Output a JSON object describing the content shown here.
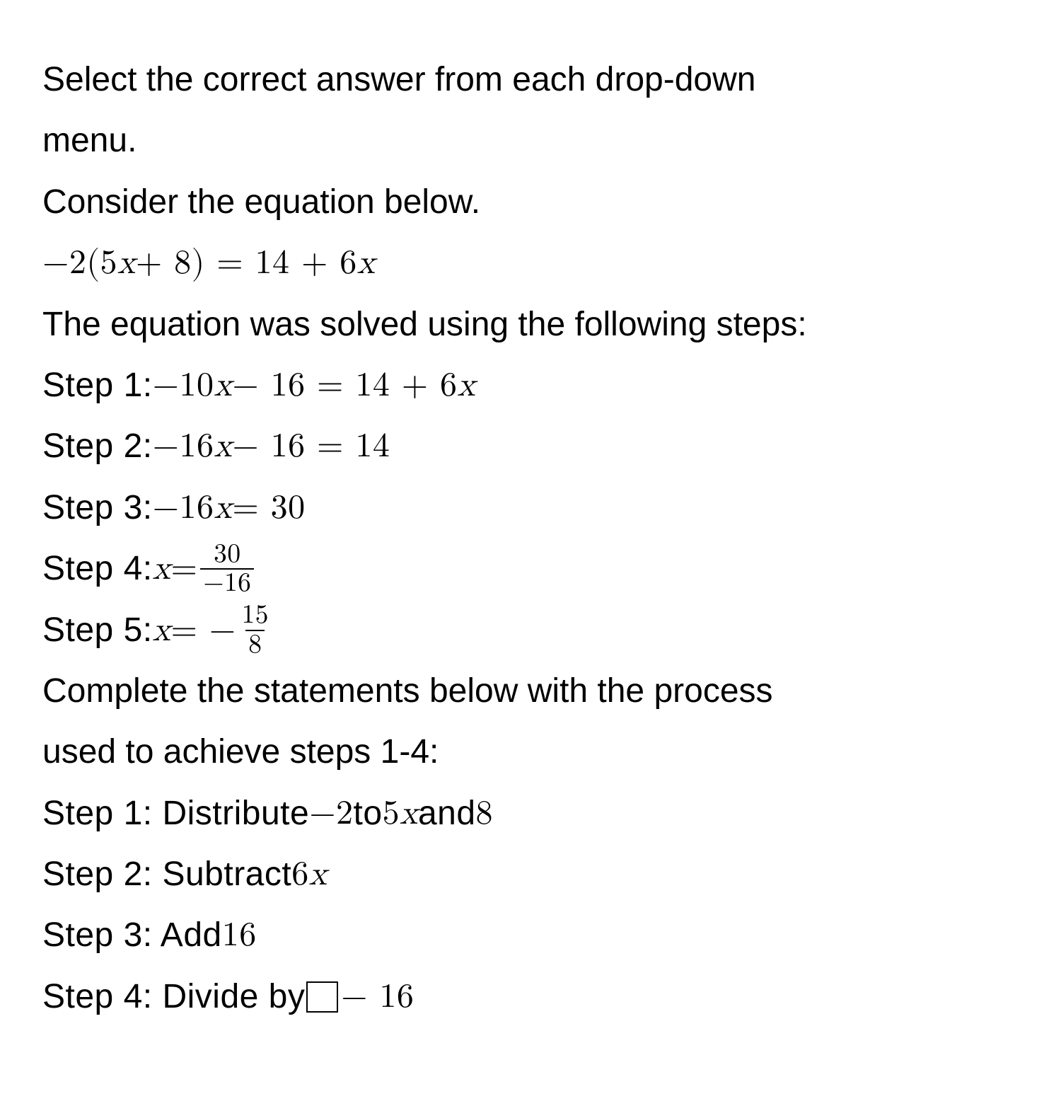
{
  "intro": {
    "line1": "Select the correct answer from each drop-down",
    "line2": "menu.",
    "consider": "Consider the equation below."
  },
  "equation": {
    "lhs_prefix": "−2(5",
    "lhs_var": "x",
    "lhs_mid": " + 8) = 14 + 6",
    "lhs_var2": "x"
  },
  "solved_intro": "The equation was solved using the following steps:",
  "steps_work": {
    "s1_label": "Step 1:  ",
    "s1_a": "−10",
    "s1_v1": "x",
    "s1_b": " − 16 = 14 + 6",
    "s1_v2": "x",
    "s2_label": "Step 2:  ",
    "s2_a": "−16",
    "s2_v1": "x",
    "s2_b": " − 16 = 14",
    "s3_label": "Step 3:  ",
    "s3_a": "−16",
    "s3_v1": "x",
    "s3_b": " = 30",
    "s4_label": "Step 4:  ",
    "s4_v": "x",
    "s4_eq": " = ",
    "s4_num": "30",
    "s4_den": "−16",
    "s5_label": "Step 5:  ",
    "s5_v": "x",
    "s5_eq": " = −",
    "s5_num": "15",
    "s5_den": "8"
  },
  "complete": {
    "line1": "Complete the statements below with the process",
    "line2": "used to achieve steps 1-4:"
  },
  "answers": {
    "s1_label": "Step 1: Distribute ",
    "s1_m1": " −2 ",
    "s1_to": " to ",
    "s1_m2": " 5",
    "s1_mv": "x",
    "s1_and": "  and ",
    "s1_m3": " 8",
    "s2_label": "Step 2: Subtract ",
    "s2_m": " 6",
    "s2_mv": "x",
    "s3_label": "Step 3: Add ",
    "s3_m": " 16",
    "s4_label": "Step 4: Divide by ",
    "s4_m": " − 16"
  }
}
